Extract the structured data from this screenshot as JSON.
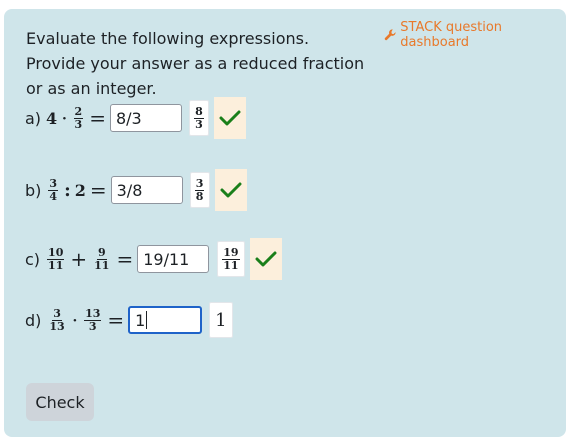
{
  "dashboard_link": "STACK question dashboard",
  "intro": "Evaluate the following expressions. Provide your answer as a reduced fraction or as an integer.",
  "questions": [
    {
      "label": "a)",
      "answer": "8/3",
      "preview_num": "8",
      "preview_den": "3",
      "correct": true
    },
    {
      "label": "b)",
      "answer": "3/8",
      "preview_num": "3",
      "preview_den": "8",
      "correct": true
    },
    {
      "label": "c)",
      "answer": "19/11",
      "preview_num": "19",
      "preview_den": "11",
      "correct": true
    },
    {
      "label": "d)",
      "answer": "1",
      "preview": "1",
      "correct": null
    }
  ],
  "math": {
    "a": {
      "int": "4",
      "op": "·",
      "num": "2",
      "den": "3",
      "eq": "="
    },
    "b": {
      "num": "3",
      "den": "4",
      "op": ":",
      "int": "2",
      "eq": "="
    },
    "c": {
      "num1": "10",
      "den1": "11",
      "op": "+",
      "num2": "9",
      "den2": "11",
      "eq": "="
    },
    "d": {
      "num1": "3",
      "den1": "13",
      "op": "·",
      "num2": "13",
      "den2": "3",
      "eq": "="
    }
  },
  "check_button": "Check",
  "colors": {
    "panel": "#cfe5ea",
    "accent": "#e8792b",
    "correct": "#1a7f1a",
    "focus": "#1f63c9"
  },
  "icons": {
    "dashboard": "wrench-icon",
    "correct": "check-icon"
  }
}
